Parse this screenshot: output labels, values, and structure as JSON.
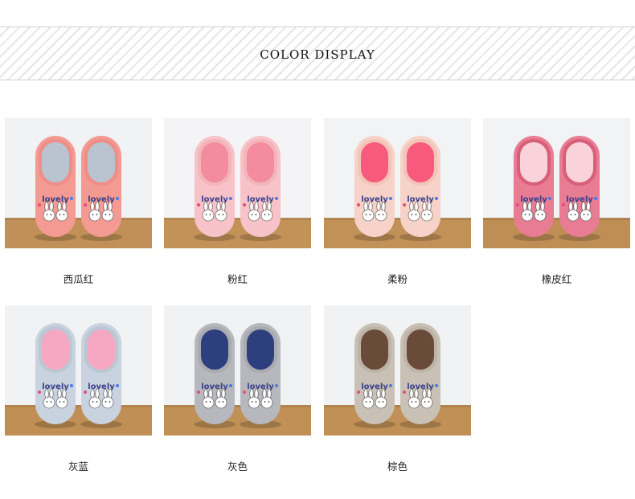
{
  "header": {
    "title": "COLOR DISPLAY"
  },
  "products": [
    {
      "label": "西瓜红",
      "colors": {
        "body": "#f39a93",
        "rim": "#ef8e88",
        "insole": "#b9c4d0",
        "wall": "#f1f2f4",
        "floor": "#c09058"
      }
    },
    {
      "label": "粉红",
      "colors": {
        "body": "#f7c3c9",
        "rim": "#f3b4ba",
        "insole": "#f28c9e",
        "wall": "#f4f4f6",
        "floor": "#c39259"
      }
    },
    {
      "label": "柔粉",
      "colors": {
        "body": "#f6d2c8",
        "rim": "#f3c5b9",
        "insole": "#f75a7c",
        "wall": "#f2f3f5",
        "floor": "#c19157"
      }
    },
    {
      "label": "橡皮红",
      "colors": {
        "body": "#e87c93",
        "rim": "#d85f7a",
        "insole": "#f9d2da",
        "wall": "#f2f3f5",
        "floor": "#bf8e55"
      }
    },
    {
      "label": "灰蓝",
      "colors": {
        "body": "#c9d3df",
        "rim": "#bcc7d4",
        "insole": "#f6a7c2",
        "wall": "#f1f2f4",
        "floor": "#c08f55"
      }
    },
    {
      "label": "灰色",
      "colors": {
        "body": "#b6b8bd",
        "rim": "#a9abb1",
        "insole": "#2e3f7e",
        "wall": "#f1f2f4",
        "floor": "#c09056"
      }
    },
    {
      "label": "棕色",
      "colors": {
        "body": "#c9c1b5",
        "rim": "#bdb4a7",
        "insole": "#6a4a38",
        "wall": "#f1f2f4",
        "floor": "#c09056"
      }
    }
  ]
}
